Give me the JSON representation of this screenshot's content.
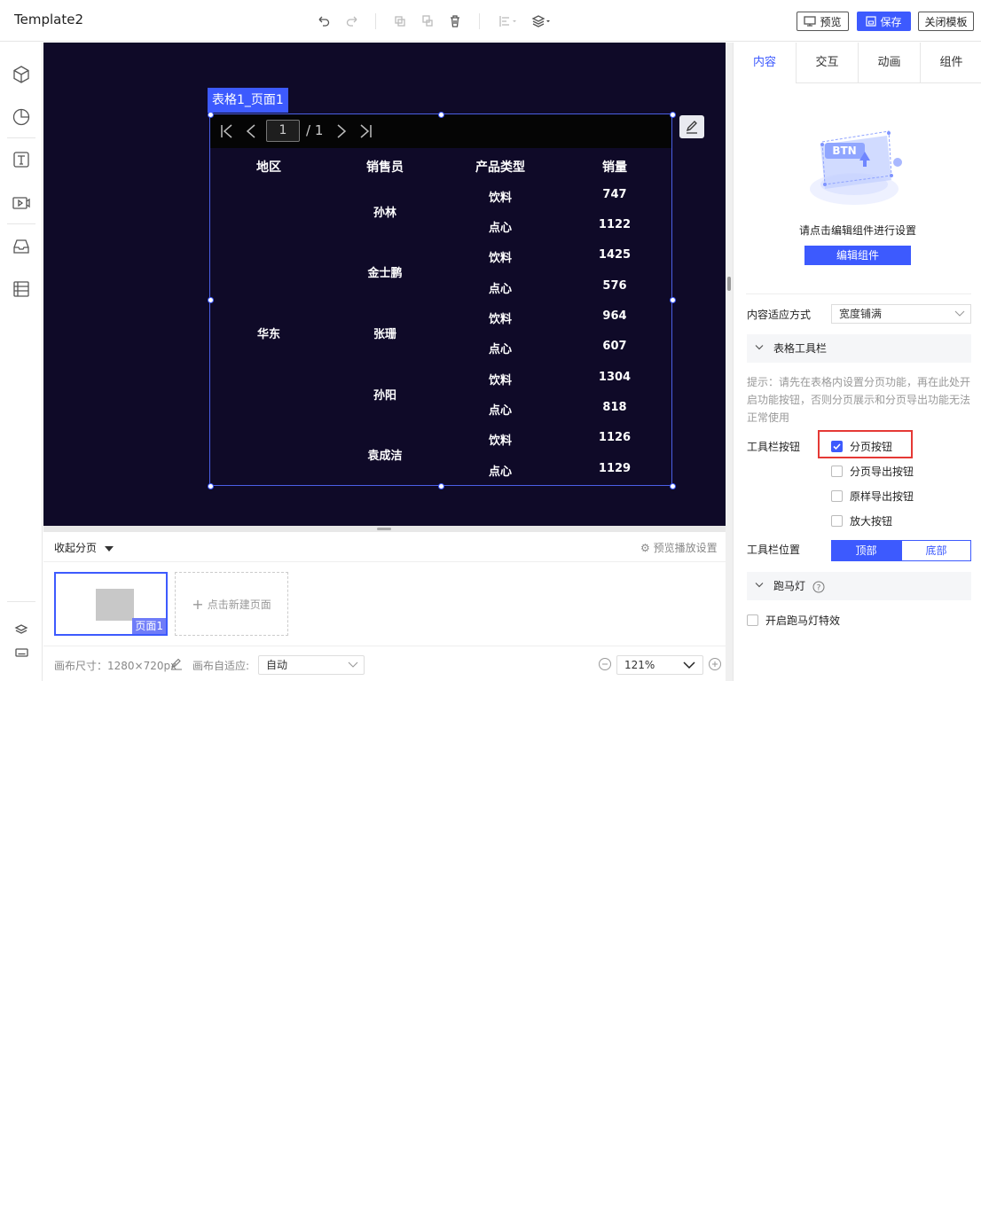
{
  "app": {
    "title": "Template2"
  },
  "toolbar": {
    "icons": [
      "undo-icon",
      "redo-icon",
      "copy-icon",
      "paste-icon",
      "delete-icon",
      "align-icon",
      "layer-icon"
    ],
    "preview_label": "预览",
    "save_label": "保存",
    "close_label": "关闭模板"
  },
  "leftbar": {
    "items": [
      "3d-box-icon",
      "chart-icon",
      "text-icon",
      "media-icon",
      "inbox-icon",
      "table-icon",
      "layers-icon",
      "keyboard-icon"
    ]
  },
  "widget": {
    "tag": "表格1_页面1",
    "pager": {
      "current": "1",
      "total": "/ 1"
    },
    "headers": [
      "地区",
      "销售员",
      "产品类型",
      "销量"
    ],
    "region": "华东",
    "sellers": [
      "孙林",
      "金士鹏",
      "张珊",
      "孙阳",
      "袁成洁"
    ],
    "rows": [
      {
        "type": "饮料",
        "qty": "747"
      },
      {
        "type": "点心",
        "qty": "1122"
      },
      {
        "type": "饮料",
        "qty": "1425"
      },
      {
        "type": "点心",
        "qty": "576"
      },
      {
        "type": "饮料",
        "qty": "964"
      },
      {
        "type": "点心",
        "qty": "607"
      },
      {
        "type": "饮料",
        "qty": "1304"
      },
      {
        "type": "点心",
        "qty": "818"
      },
      {
        "type": "饮料",
        "qty": "1126"
      },
      {
        "type": "点心",
        "qty": "1129"
      }
    ]
  },
  "pages": {
    "collapse_label": "收起分页",
    "preview_settings": "预览播放设置",
    "thumb_label": "页面1",
    "new_page": "点击新建页面"
  },
  "status": {
    "canvas_size": "画布尺寸：1280×720px",
    "auto_fit_label": "画布自适应:",
    "auto_fit_value": "自动",
    "zoom": "121%"
  },
  "panel": {
    "tabs": [
      "内容",
      "交互",
      "动画",
      "组件"
    ],
    "illustration_text": "BTN",
    "hint": "请点击编辑组件进行设置",
    "edit_button": "编辑组件",
    "fit_label": "内容适应方式",
    "fit_value": "宽度铺满",
    "toolbar_section": "表格工具栏",
    "tip": "提示：请先在表格内设置分页功能，再在此处开启功能按钮，否则分页展示和分页导出功能无法正常使用",
    "buttons_label": "工具栏按钮",
    "options": [
      {
        "label": "分页按钮",
        "checked": true
      },
      {
        "label": "分页导出按钮",
        "checked": false
      },
      {
        "label": "原样导出按钮",
        "checked": false
      },
      {
        "label": "放大按钮",
        "checked": false
      }
    ],
    "position_label": "工具栏位置",
    "position_top": "顶部",
    "position_bottom": "底部",
    "marquee_section": "跑马灯",
    "marquee_effect": "开启跑马灯特效"
  },
  "colors": {
    "accent": "#3d5afe",
    "canvas_bg": "#0f0a28",
    "highlight": "#e53935"
  }
}
